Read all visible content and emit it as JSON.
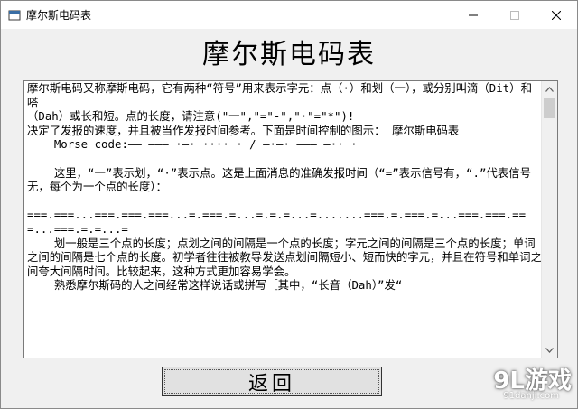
{
  "window": {
    "title": "摩尔斯电码表"
  },
  "heading": "摩尔斯电码表",
  "text_box": {
    "content": "摩尔斯电码又称摩斯电码，它有两种“符号”用来表示字元：点（·）和划（一），或分别叫滴（Dit）和嗒\n（Dah）或长和短。点的长度，请注意(\"一\",\"=\"-\",\"·\"=\"*\")!\n决定了发报的速度，并且被当作发报时间参考。下面是时间控制的图示： 摩尔斯电码表\n    Morse code:—— ——— ·—· ···· · / —·—· ——— —·· ·\n\n    这里，“一”表示划，“·”表示点。这是上面消息的准确发报时间（“=”表示信号有，“.”代表信号无，每个为一个点的长度）：\n\n===.===...===.===.===...=.===.=...=.=.=...=.......===.=.===.=...===.===.===...===.=.=...=\n    划一般是三个点的长度；点划之间的间隔是一个点的长度；字元之间的间隔是三个点的长度；单词之间的间隔是七个点的长度。初学者往往被教导发送点划间隔短小、短而快的字元，并且在符号和单词之间夸大间隔时间。比较起来，这种方式更加容易学会。\n    熟悉摩尔斯码的人之间经常这样说话或拼写［其中，“长音（Dah）”发“"
  },
  "back_button": {
    "label": "返回"
  },
  "watermark": {
    "logo": "9L游戏",
    "url": "91danji.com"
  }
}
